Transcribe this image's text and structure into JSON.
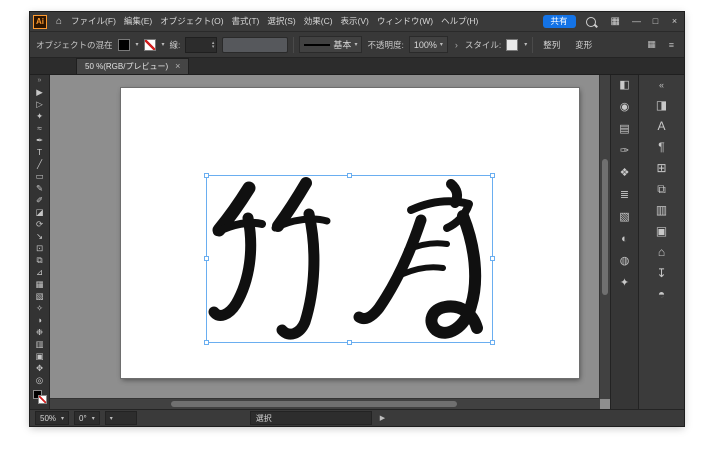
{
  "app": {
    "title": "Adobe Illustrator"
  },
  "colors": {
    "accent_blue": "#1473e6",
    "selection_blue": "#6aaef0",
    "artwork_black": "#101010"
  },
  "titlebar": {
    "app_icon_label": "Ai",
    "home_glyph": "⌂",
    "menus": [
      "ファイル(F)",
      "編集(E)",
      "オブジェクト(O)",
      "書式(T)",
      "選択(S)",
      "効果(C)",
      "表示(V)",
      "ウィンドウ(W)",
      "ヘルプ(H)"
    ],
    "share_button": "共有",
    "workspace_glyph": "▦",
    "minimize_glyph": "—",
    "maximize_glyph": "□",
    "close_glyph": "×"
  },
  "control_bar": {
    "context_label": "オブジェクトの混在",
    "stroke_weight_label": "線:",
    "spin_up": "▴",
    "spin_down": "▾",
    "brush_definition_label": "基本",
    "opacity_label": "不透明度:",
    "opacity_value": "100%",
    "style_label": "スタイル:",
    "align_button": "整列",
    "transform_button": "変形",
    "chevron": "▾",
    "chevron_right": "›",
    "grid_glyph": "▦",
    "menu_glyph": "≡"
  },
  "tab": {
    "title": "50 %(RGB/プレビュー)",
    "close_glyph": "×"
  },
  "toolbar": {
    "expand_glyph": "»",
    "tools": [
      {
        "name": "selection-tool",
        "glyph": "▶"
      },
      {
        "name": "direct-selection-tool",
        "glyph": "▷"
      },
      {
        "name": "magic-wand-tool",
        "glyph": "✦"
      },
      {
        "name": "lasso-tool",
        "glyph": "≈"
      },
      {
        "name": "pen-tool",
        "glyph": "✒"
      },
      {
        "name": "type-tool",
        "glyph": "T"
      },
      {
        "name": "line-segment-tool",
        "glyph": "╱"
      },
      {
        "name": "rectangle-tool",
        "glyph": "▭"
      },
      {
        "name": "paintbrush-tool",
        "glyph": "✎"
      },
      {
        "name": "pencil-tool",
        "glyph": "✐"
      },
      {
        "name": "eraser-tool",
        "glyph": "◪"
      },
      {
        "name": "rotate-tool",
        "glyph": "⟳"
      },
      {
        "name": "scale-tool",
        "glyph": "↘"
      },
      {
        "name": "free-transform-tool",
        "glyph": "⊡"
      },
      {
        "name": "shape-builder-tool",
        "glyph": "⧉"
      },
      {
        "name": "perspective-grid-tool",
        "glyph": "⊿"
      },
      {
        "name": "mesh-tool",
        "glyph": "▦"
      },
      {
        "name": "gradient-tool",
        "glyph": "▧"
      },
      {
        "name": "eyedropper-tool",
        "glyph": "✧"
      },
      {
        "name": "blend-tool",
        "glyph": "◑"
      },
      {
        "name": "symbol-sprayer-tool",
        "glyph": "❉"
      },
      {
        "name": "column-graph-tool",
        "glyph": "▥"
      },
      {
        "name": "artboard-tool",
        "glyph": "▣"
      },
      {
        "name": "hand-tool",
        "glyph": "✥"
      },
      {
        "name": "zoom-tool",
        "glyph": "◎"
      }
    ]
  },
  "canvas": {
    "artwork_characters": "竹虎"
  },
  "dock": {
    "collapse_glyph": "«",
    "strip_a": [
      {
        "name": "color-panel-icon",
        "glyph": "◧"
      },
      {
        "name": "color-guide-panel-icon",
        "glyph": "◉"
      },
      {
        "name": "swatches-panel-icon",
        "glyph": "▤"
      },
      {
        "name": "brushes-panel-icon",
        "glyph": "✑"
      },
      {
        "name": "symbols-panel-icon",
        "glyph": "❖"
      },
      {
        "name": "stroke-panel-icon",
        "glyph": "≣"
      },
      {
        "name": "gradient-panel-icon",
        "glyph": "▧"
      },
      {
        "name": "transparency-panel-icon",
        "glyph": "◐"
      },
      {
        "name": "appearance-panel-icon",
        "glyph": "◍"
      },
      {
        "name": "graphic-styles-panel-icon",
        "glyph": "✦"
      }
    ],
    "strip_b": [
      {
        "name": "properties-panel-icon",
        "glyph": "◨"
      },
      {
        "name": "character-panel-icon",
        "glyph": "A"
      },
      {
        "name": "paragraph-panel-icon",
        "glyph": "¶"
      },
      {
        "name": "align-panel-icon",
        "glyph": "⊞"
      },
      {
        "name": "pathfinder-panel-icon",
        "glyph": "⧉"
      },
      {
        "name": "layers-panel-icon",
        "glyph": "▥"
      },
      {
        "name": "artboards-panel-icon",
        "glyph": "▣"
      },
      {
        "name": "libraries-panel-icon",
        "glyph": "⌂"
      },
      {
        "name": "asset-export-panel-icon",
        "glyph": "↧"
      },
      {
        "name": "comments-panel-icon",
        "glyph": "◓"
      }
    ]
  },
  "status_bar": {
    "zoom_value": "50%",
    "rotation_value": "0°",
    "tool_status": "選択",
    "next_glyph": "▶",
    "chevron": "▾"
  }
}
